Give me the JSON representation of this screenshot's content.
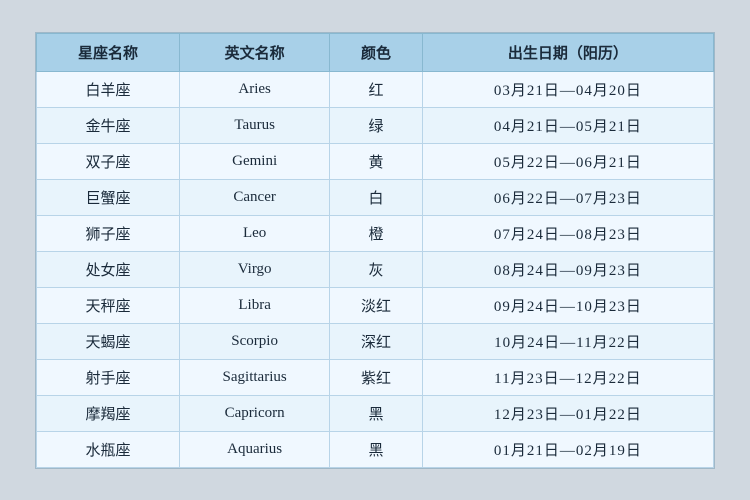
{
  "table": {
    "headers": [
      "星座名称",
      "英文名称",
      "颜色",
      "出生日期（阳历）"
    ],
    "rows": [
      {
        "chinese": "白羊座",
        "english": "Aries",
        "color": "红",
        "dates": "03月21日—04月20日"
      },
      {
        "chinese": "金牛座",
        "english": "Taurus",
        "color": "绿",
        "dates": "04月21日—05月21日"
      },
      {
        "chinese": "双子座",
        "english": "Gemini",
        "color": "黄",
        "dates": "05月22日—06月21日"
      },
      {
        "chinese": "巨蟹座",
        "english": "Cancer",
        "color": "白",
        "dates": "06月22日—07月23日"
      },
      {
        "chinese": "狮子座",
        "english": "Leo",
        "color": "橙",
        "dates": "07月24日—08月23日"
      },
      {
        "chinese": "处女座",
        "english": "Virgo",
        "color": "灰",
        "dates": "08月24日—09月23日"
      },
      {
        "chinese": "天秤座",
        "english": "Libra",
        "color": "淡红",
        "dates": "09月24日—10月23日"
      },
      {
        "chinese": "天蝎座",
        "english": "Scorpio",
        "color": "深红",
        "dates": "10月24日—11月22日"
      },
      {
        "chinese": "射手座",
        "english": "Sagittarius",
        "color": "紫红",
        "dates": "11月23日—12月22日"
      },
      {
        "chinese": "摩羯座",
        "english": "Capricorn",
        "color": "黑",
        "dates": "12月23日—01月22日"
      },
      {
        "chinese": "水瓶座",
        "english": "Aquarius",
        "color": "黑",
        "dates": "01月21日—02月19日"
      }
    ]
  }
}
